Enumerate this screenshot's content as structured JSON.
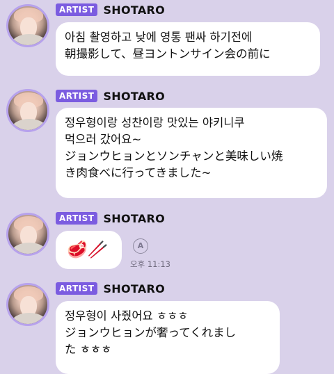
{
  "messages": [
    {
      "badge": "ARTIST",
      "sender": "SHOTARO",
      "lines": [
        "아침 촬영하고 낮에 영통 팬싸 하기전에",
        "朝撮影して、昼ヨントンサイン会の前に"
      ]
    },
    {
      "badge": "ARTIST",
      "sender": "SHOTARO",
      "lines": [
        "정우형이랑 성찬이랑 맛있는 야키니쿠",
        "먹으러 갔어요~",
        "ジョンウヒョンとソンチャンと美味しい焼",
        "き肉食べに行ってきました~"
      ]
    },
    {
      "badge": "ARTIST",
      "sender": "SHOTARO",
      "emoji": "🥩🥢",
      "translate_icon": "translate-icon",
      "translate_glyph": "A",
      "time": "오후 11:13"
    },
    {
      "badge": "ARTIST",
      "sender": "SHOTARO",
      "lines": [
        "정우형이 사줬어요 ㅎㅎㅎ",
        "ジョンウヒョンが奢ってくれまし",
        "た ㅎㅎㅎ"
      ]
    }
  ],
  "colors": {
    "background": "#d9d1ea",
    "badge": "#7b5ce0",
    "avatar_ring": "#b7a2ec",
    "bubble": "#ffffff"
  }
}
